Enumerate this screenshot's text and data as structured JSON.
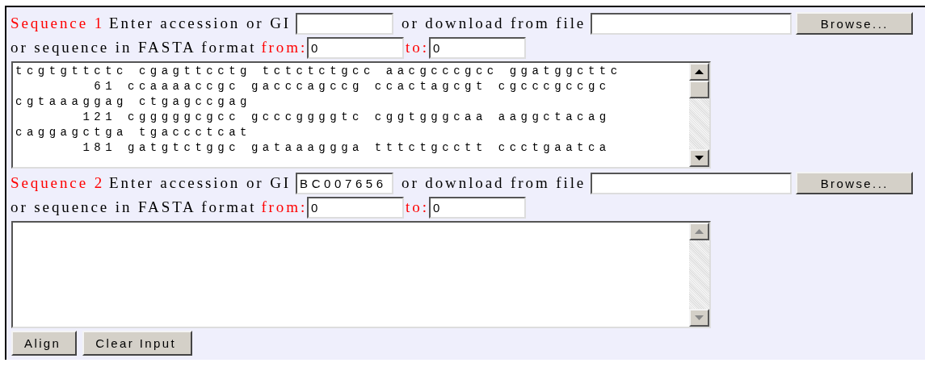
{
  "sequences": [
    {
      "label": "Sequence 1",
      "accession_label": "Enter accession or GI",
      "file_label": "or download from file",
      "browse": "Browse...",
      "fasta_label": "or sequence in FASTA format",
      "from_label": "from:",
      "from": "0",
      "to_label": "to:",
      "to": "0",
      "sequence": [
        "tcgtgttctc cgagttcctg tctctctgcc aacgcccgcc ggatggcttc",
        "       61 ccaaaaccgc gacccagccg ccactagcgt cgcccgccgc",
        "cgtaaaggag ctgagccgag",
        "      121 cgggggcgcc gcccggggtc cggtgggcaa aaggctacag",
        "caggagctga tgaccctcat",
        "      181 gatgtctggc gataaaggga tttctgcctt ccctgaatca"
      ]
    },
    {
      "label": "Sequence 2",
      "accession_label": "Enter accession or GI",
      "accession": "BC007656",
      "file_label": "or download from file",
      "browse": "Browse...",
      "fasta_label": "or sequence in FASTA format",
      "from_label": "from:",
      "from": "0",
      "to_label": "to:",
      "to": "0"
    }
  ],
  "buttons": [
    "Align",
    "Clear Input"
  ]
}
